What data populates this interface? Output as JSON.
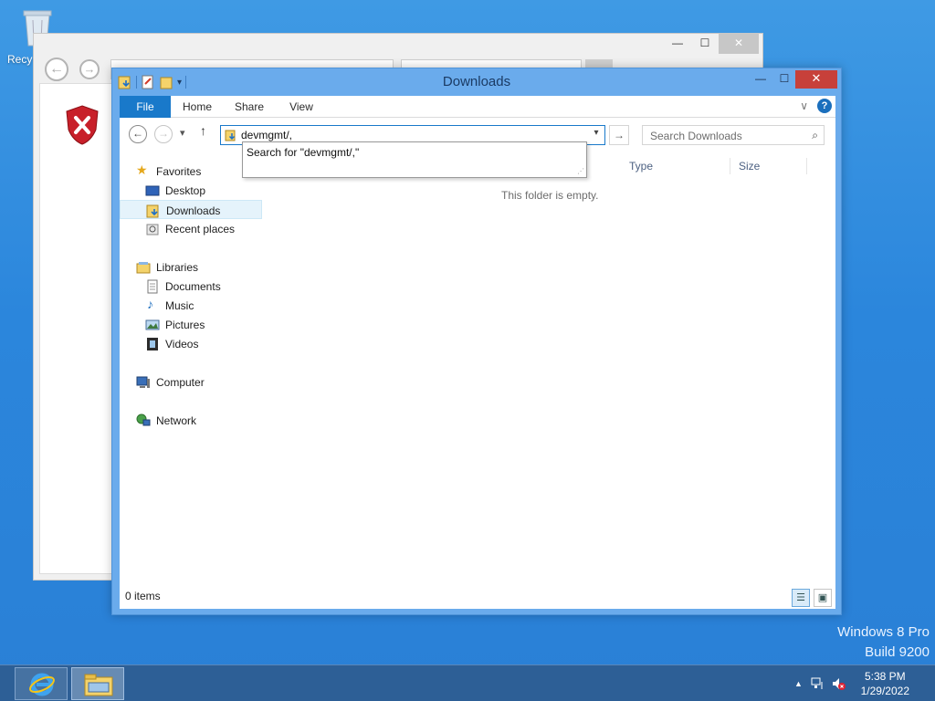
{
  "desktop": {
    "recycle_label": "Recy",
    "watermark_line1": "Windows 8 Pro",
    "watermark_line2": "Build 9200"
  },
  "ie_window": {
    "minimize": "—",
    "maximize": "☐",
    "close": "✕"
  },
  "explorer": {
    "title": "Downloads",
    "window_controls": {
      "minimize": "—",
      "maximize": "☐",
      "close": "✕"
    },
    "ribbon_tabs": [
      "File",
      "Home",
      "Share",
      "View"
    ],
    "help": "?",
    "collapse": "∨",
    "nav": {
      "back": "←",
      "forward": "→",
      "recent": "▾",
      "up": "↑",
      "go": "→"
    },
    "address": {
      "value": "devmgmt/,",
      "dropdown": "▾"
    },
    "suggestion": "Search for \"devmgmt/,\"",
    "search": {
      "placeholder": "Search Downloads",
      "icon": "⌕"
    },
    "nav_pane": {
      "favorites_header": "Favorites",
      "favorites": [
        "Desktop",
        "Downloads",
        "Recent places"
      ],
      "libraries_header": "Libraries",
      "libraries": [
        "Documents",
        "Music",
        "Pictures",
        "Videos"
      ],
      "computer": "Computer",
      "network": "Network"
    },
    "columns": [
      "Type",
      "Size"
    ],
    "empty_message": "This folder is empty.",
    "status": "0 items",
    "view_buttons": {
      "details": "☰",
      "large": "▣"
    }
  },
  "taskbar": {
    "clock_time": "5:38 PM",
    "clock_date": "1/29/2022",
    "tray_chevron": "▲"
  },
  "colors": {
    "accent": "#1979ca",
    "desktop": "#2b86dc",
    "window_frame": "#6aabec",
    "close_button": "#c7403a"
  }
}
